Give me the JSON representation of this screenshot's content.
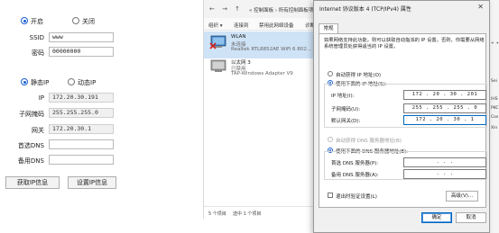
{
  "tool": {
    "power": {
      "on_label": "开启",
      "off_label": "关闭",
      "selected": "on"
    },
    "ssid": {
      "label": "SSID",
      "value": "www"
    },
    "password": {
      "label": "密码",
      "value": "00000000"
    },
    "ip_mode": {
      "static_label": "静态IP",
      "dynamic_label": "动态IP",
      "selected": "static"
    },
    "ip": {
      "label": "IP",
      "value": "172.20.30.191"
    },
    "subnet": {
      "label": "子网掩码",
      "value": "255.255.255.0"
    },
    "gateway": {
      "label": "网关",
      "value": "172.20.30.1"
    },
    "dns1": {
      "label": "首选DNS",
      "value": ""
    },
    "dns2": {
      "label": "备用DNS",
      "value": ""
    },
    "get_button": "获取IP信息",
    "set_button": "设置IP信息"
  },
  "netwin": {
    "nav": "← → ↑",
    "breadcrumb": "« 控制面板 › 所有控制面板项 › 网络连接",
    "cmd_org": "组织 ▾",
    "cmd_connect": "连接到",
    "cmd_disable": "禁用此网络设备",
    "cmd_diag": "诊断这个连接",
    "adapters": [
      {
        "name": "WLAN",
        "status": "未连接",
        "device": "Realtek RTL8852AE WiFi 6 802..."
      },
      {
        "name": "以太网 3",
        "status": "已禁用",
        "device": "TAP-Windows Adapter V9"
      }
    ],
    "status_count": "5 个项目",
    "status_selected": "选中 1 个项目"
  },
  "dialog": {
    "title": "Internet 协议版本 4 (TCP/IPv4) 属性",
    "tab": "常规",
    "description": "如果网络支持此功能，则可以获取自动指派的 IP 设置。否则，你需要从网络系统管理员处获得适当的 IP 设置。",
    "auto_ip": "自动获得 IP 地址(O)",
    "manual_ip": "使用下面的 IP 地址(S):",
    "ip_label": "IP 地址(I):",
    "ip_value": "172 . 20 . 30 . 201",
    "mask_label": "子网掩码(U):",
    "mask_value": "255 . 255 . 255 . 0",
    "gw_label": "默认网关(D):",
    "gw_value": "172 . 20 . 30 . 1",
    "auto_dns": "自动获得 DNS 服务器地址(B)",
    "manual_dns": "使用下面的 DNS 服务器地址(E):",
    "dns1_label": "首选 DNS 服务器(P):",
    "dns2_label": "备用 DNS 服务器(A):",
    "dns_empty": ".      .      .",
    "validate": "退出时验证设置(L)",
    "advanced": "高级(V)...",
    "ok": "确定",
    "cancel": "取消"
  },
  "strip": [
    "Sei",
    "IHS",
    "PKC",
    "Cos",
    "Xin",
    "+ +"
  ]
}
